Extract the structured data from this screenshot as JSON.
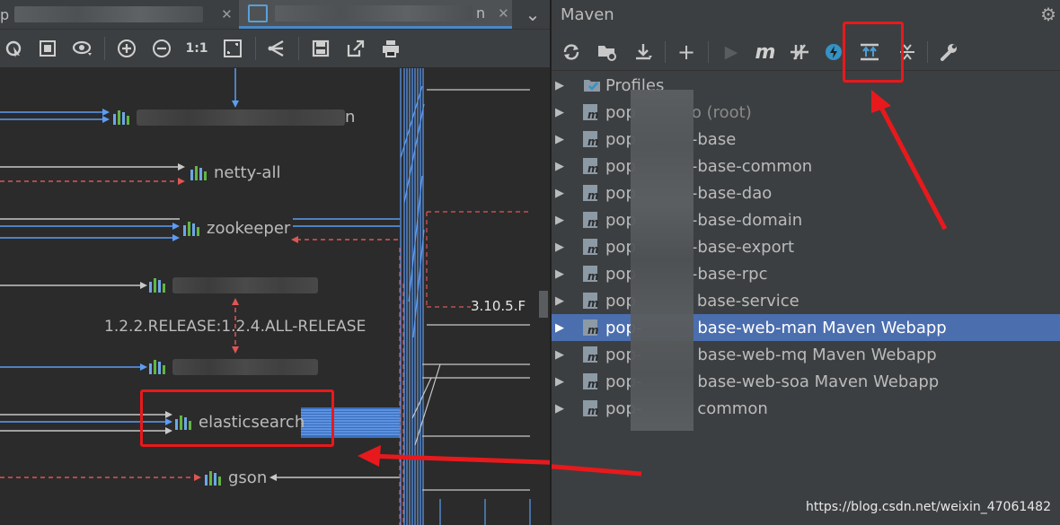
{
  "editor": {
    "tabs": [
      {
        "label": "p",
        "close": "✕"
      },
      {
        "label": "n",
        "close": "✕"
      }
    ],
    "tab_menu": "⌄",
    "toolbar": {
      "icons": [
        "select-pointer-icon",
        "fit-content-icon",
        "show-options-icon",
        "zoom-in-icon",
        "zoom-out-icon",
        "actual-size-icon",
        "fit-page-icon",
        "layout-icon",
        "save-icon",
        "export-icon",
        "print-icon"
      ],
      "actual_size_label": "1:1"
    }
  },
  "diagram": {
    "nodes": [
      {
        "id": "top-blurred",
        "label": "n"
      },
      {
        "id": "netty",
        "label": "netty-all"
      },
      {
        "id": "zookeeper",
        "label": "zookeeper"
      },
      {
        "id": "blurred-1",
        "label": ""
      },
      {
        "id": "blurred-2",
        "label": ""
      },
      {
        "id": "elasticsearch",
        "label": "elasticsearch"
      },
      {
        "id": "gson",
        "label": "gson"
      }
    ],
    "conflict_label": "1.2.2.RELEASE:1.2.4.ALL-RELEASE",
    "version_label": "3.10.5.F",
    "colors": {
      "dep": "#5c9cf5",
      "conflict": "#e05555",
      "plain": "#c8c8c8",
      "highlight": "#e8191c"
    }
  },
  "maven": {
    "title": "Maven",
    "toolbar_icons": [
      "reimport-icon",
      "generate-sources-icon",
      "download-icon",
      "add-icon",
      "run-icon",
      "maven-goal-icon",
      "toggle-offline-icon",
      "skip-tests-icon",
      "show-dependencies-icon",
      "collapse-all-icon",
      "settings-wrench-icon"
    ],
    "tree": [
      {
        "label": "Profiles",
        "kind": "profiles",
        "selected": false
      },
      {
        "label": "pop",
        "suffix": "o (root)",
        "kind": "project",
        "selected": false
      },
      {
        "label": "pop",
        "suffix": "-base",
        "kind": "project",
        "selected": false
      },
      {
        "label": "pop",
        "suffix": "-base-common",
        "kind": "project",
        "selected": false
      },
      {
        "label": "pop",
        "suffix": "-base-dao",
        "kind": "project",
        "selected": false
      },
      {
        "label": "pop",
        "suffix": "-base-domain",
        "kind": "project",
        "selected": false
      },
      {
        "label": "pop",
        "suffix": "-base-export",
        "kind": "project",
        "selected": false
      },
      {
        "label": "pop",
        "suffix": "-base-rpc",
        "kind": "project",
        "selected": false
      },
      {
        "label": "pop",
        "suffix": "base-service",
        "kind": "project",
        "selected": false
      },
      {
        "label": "pop-",
        "suffix": "base-web-man Maven Webapp",
        "kind": "project",
        "selected": true
      },
      {
        "label": "pop-",
        "suffix": "base-web-mq Maven Webapp",
        "kind": "project",
        "selected": false
      },
      {
        "label": "pop-",
        "suffix": "base-web-soa Maven Webapp",
        "kind": "project",
        "selected": false
      },
      {
        "label": "pop-",
        "suffix": "common",
        "kind": "project",
        "selected": false
      }
    ]
  },
  "watermark": "https://blog.csdn.net/weixin_47061482"
}
